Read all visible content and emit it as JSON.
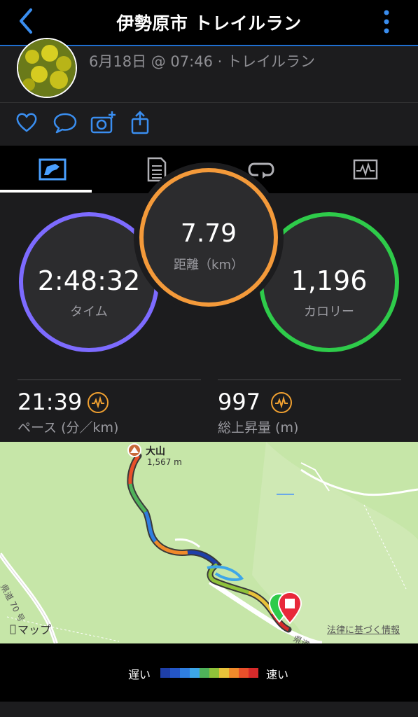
{
  "header": {
    "title": "伊勢原市 トレイルラン",
    "back_icon": "chevron-left-icon",
    "menu_icon": "kebab-icon"
  },
  "activity": {
    "meta": "6月18日 @ 07:46 · トレイルラン"
  },
  "social": {
    "icons": [
      "heart-icon",
      "comment-icon",
      "add-photo-icon",
      "share-icon"
    ]
  },
  "tabs": [
    "overview-icon",
    "details-icon",
    "laps-icon",
    "charts-icon"
  ],
  "rings": {
    "time": {
      "value": "2:48:32",
      "label": "タイム",
      "color": "#7d6bff"
    },
    "distance": {
      "value": "7.79",
      "label": "距離（km）",
      "color": "#f49a3a"
    },
    "calories": {
      "value": "1,196",
      "label": "カロリー",
      "color": "#2ecb4a"
    }
  },
  "metrics": {
    "pace": {
      "value": "21:39",
      "label": "ペース (分／km)"
    },
    "ascent": {
      "value": "997",
      "label": "総上昇量 (m)"
    }
  },
  "map": {
    "peak_name": "大山",
    "peak_elev": "1,567 m",
    "road1": "県道 70 号",
    "road2": "県道",
    "brand": "マップ",
    "legal": "法律に基づく情報"
  },
  "legend": {
    "slow": "遅い",
    "fast": "速い",
    "colors": [
      "#1e3fa8",
      "#2456c8",
      "#2f7ee0",
      "#3da6e8",
      "#4fb25a",
      "#8fc23a",
      "#e8c23a",
      "#f08a2a",
      "#e8502a",
      "#d62a2a"
    ]
  }
}
